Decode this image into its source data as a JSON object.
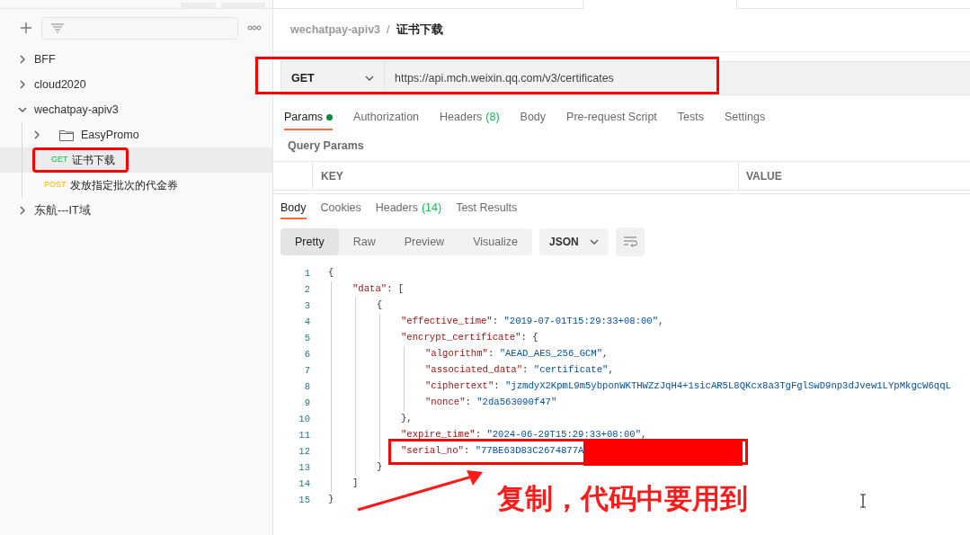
{
  "sidebar": {
    "items": [
      {
        "kind": "collection",
        "label": "BFF",
        "expanded": false,
        "selected": false
      },
      {
        "kind": "collection",
        "label": "cloud2020",
        "expanded": false,
        "selected": false
      },
      {
        "kind": "collection",
        "label": "wechatpay-apiv3",
        "expanded": true,
        "selected": false,
        "children": [
          {
            "kind": "folder",
            "label": "EasyPromo",
            "expanded": false,
            "selected": false
          },
          {
            "kind": "request",
            "method": "GET",
            "label": "证书下载",
            "selected": true
          },
          {
            "kind": "request",
            "method": "POST",
            "label": "发放指定批次的代金券",
            "selected": false
          }
        ]
      },
      {
        "kind": "collection",
        "label": "东航---IT域",
        "expanded": false,
        "selected": false
      }
    ]
  },
  "breadcrumb": {
    "parent": "wechatpay-apiv3",
    "separator": "/",
    "current": "证书下载"
  },
  "request": {
    "method": "GET",
    "url": "https://api.mch.weixin.qq.com/v3/certificates"
  },
  "request_tabs": [
    {
      "label": "Params",
      "dot": true,
      "selected": true
    },
    {
      "label": "Authorization",
      "dot": false,
      "selected": false
    },
    {
      "label": "Headers",
      "count": "(8)",
      "dot": false,
      "selected": false
    },
    {
      "label": "Body",
      "dot": false,
      "selected": false
    },
    {
      "label": "Pre-request Script",
      "dot": false,
      "selected": false
    },
    {
      "label": "Tests",
      "dot": false,
      "selected": false
    },
    {
      "label": "Settings",
      "dot": false,
      "selected": false
    }
  ],
  "query_params": {
    "title": "Query Params",
    "columns": [
      "KEY",
      "VALUE"
    ]
  },
  "response_tabs": [
    {
      "label": "Body",
      "selected": true
    },
    {
      "label": "Cookies",
      "selected": false
    },
    {
      "label": "Headers",
      "count": "(14)",
      "selected": false
    },
    {
      "label": "Test Results",
      "selected": false
    }
  ],
  "view_modes": [
    {
      "label": "Pretty",
      "selected": true
    },
    {
      "label": "Raw",
      "selected": false
    },
    {
      "label": "Preview",
      "selected": false
    },
    {
      "label": "Visualize",
      "selected": false
    }
  ],
  "format": "JSON",
  "line_numbers": [
    "1",
    "2",
    "3",
    "4",
    "5",
    "6",
    "7",
    "8",
    "9",
    "10",
    "11",
    "12",
    "13",
    "14",
    "15"
  ],
  "code": [
    {
      "parts": [
        {
          "kind": "punct",
          "text": "{"
        }
      ],
      "children": [
        {
          "parts": [
            {
              "kind": "key",
              "text": "\"data\""
            },
            {
              "kind": "punct",
              "text": ": ["
            }
          ],
          "children": [
            {
              "parts": [
                {
                  "kind": "punct",
                  "text": "{"
                }
              ],
              "children": [
                {
                  "parts": [
                    {
                      "kind": "key",
                      "text": "\"effective_time\""
                    },
                    {
                      "kind": "punct",
                      "text": ": "
                    },
                    {
                      "kind": "value",
                      "text": "\"2019-07-01T15:29:33+08:00\""
                    },
                    {
                      "kind": "punct",
                      "text": ","
                    }
                  ]
                },
                {
                  "parts": [
                    {
                      "kind": "key",
                      "text": "\"encrypt_certificate\""
                    },
                    {
                      "kind": "punct",
                      "text": ": {"
                    }
                  ],
                  "children": [
                    {
                      "parts": [
                        {
                          "kind": "key",
                          "text": "\"algorithm\""
                        },
                        {
                          "kind": "punct",
                          "text": ": "
                        },
                        {
                          "kind": "value",
                          "text": "\"AEAD_AES_256_GCM\""
                        },
                        {
                          "kind": "punct",
                          "text": ","
                        }
                      ]
                    },
                    {
                      "parts": [
                        {
                          "kind": "key",
                          "text": "\"associated_data\""
                        },
                        {
                          "kind": "punct",
                          "text": ": "
                        },
                        {
                          "kind": "value",
                          "text": "\"certificate\""
                        },
                        {
                          "kind": "punct",
                          "text": ","
                        }
                      ]
                    },
                    {
                      "parts": [
                        {
                          "kind": "key",
                          "text": "\"ciphertext\""
                        },
                        {
                          "kind": "punct",
                          "text": ": "
                        },
                        {
                          "kind": "value",
                          "text": "\"jzmdyX2KpmL9m5ybponWKTHWZzJqH4+1sicAR5L8QKcx8a3TgFglSwD9np3dJvew1LYpMkgcW6qqL"
                        }
                      ]
                    },
                    {
                      "parts": [
                        {
                          "kind": "key",
                          "text": "\"nonce\""
                        },
                        {
                          "kind": "punct",
                          "text": ": "
                        },
                        {
                          "kind": "value",
                          "text": "\"2da563090f47\""
                        }
                      ]
                    }
                  ]
                },
                {
                  "parts": [
                    {
                      "kind": "punct",
                      "text": "},"
                    }
                  ]
                },
                {
                  "parts": [
                    {
                      "kind": "key",
                      "text": "\"expire_time\""
                    },
                    {
                      "kind": "punct",
                      "text": ": "
                    },
                    {
                      "kind": "value",
                      "text": "\"2024-06-29T15:29:33+08:00\""
                    },
                    {
                      "kind": "punct",
                      "text": ","
                    }
                  ]
                },
                {
                  "parts": [
                    {
                      "kind": "key",
                      "text": "\"serial_no\""
                    },
                    {
                      "kind": "punct",
                      "text": ": "
                    },
                    {
                      "kind": "value",
                      "text": "\"77BE63D83C2674877A"
                    }
                  ],
                  "redacted": true
                }
              ]
            },
            {
              "parts": [
                {
                  "kind": "punct",
                  "text": "}"
                }
              ]
            }
          ]
        },
        {
          "parts": [
            {
              "kind": "punct",
              "text": "]"
            }
          ]
        }
      ]
    },
    {
      "parts": [
        {
          "kind": "punct",
          "text": "}"
        }
      ]
    }
  ],
  "annotation": {
    "text": "复制，代码中要用到"
  }
}
